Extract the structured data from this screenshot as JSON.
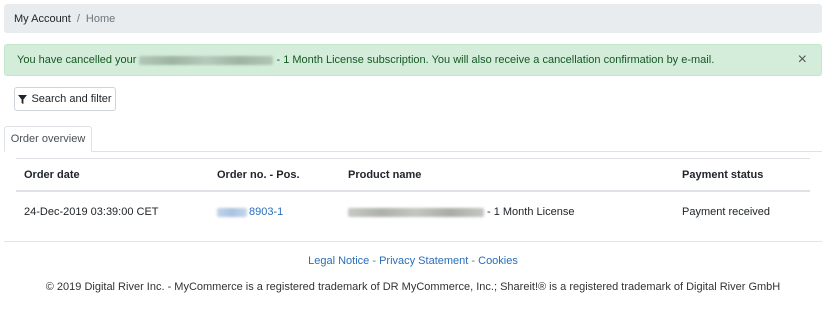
{
  "breadcrumb": {
    "account": "My Account",
    "separator": "/",
    "current": "Home"
  },
  "alert": {
    "text_before": "You have cancelled your",
    "text_after": "- 1 Month License subscription. You will also receive a cancellation confirmation by e-mail.",
    "close_label": "×"
  },
  "toolbar": {
    "filter_label": "Search and filter"
  },
  "tabs": [
    {
      "label": "Order overview"
    }
  ],
  "table": {
    "headers": [
      "Order date",
      "Order no. - Pos.",
      "Product name",
      "Payment status"
    ],
    "rows": [
      {
        "date": "24-Dec-2019 03:39:00 CET",
        "order_suffix": "8903-1",
        "product_suffix": "- 1 Month License",
        "status": "Payment received"
      }
    ]
  },
  "footer": {
    "legal": "Legal Notice",
    "privacy": "Privacy Statement",
    "cookies": "Cookies",
    "sep": "-",
    "copyright": "© 2019 Digital River Inc. - MyCommerce is a registered trademark of DR MyCommerce, Inc.; Shareit!® is a registered trademark of Digital River GmbH"
  },
  "colors": {
    "alert_bg": "#d4edda",
    "alert_text": "#155724",
    "link": "#2a6ebb",
    "breadcrumb_bg": "#e9ecef"
  }
}
